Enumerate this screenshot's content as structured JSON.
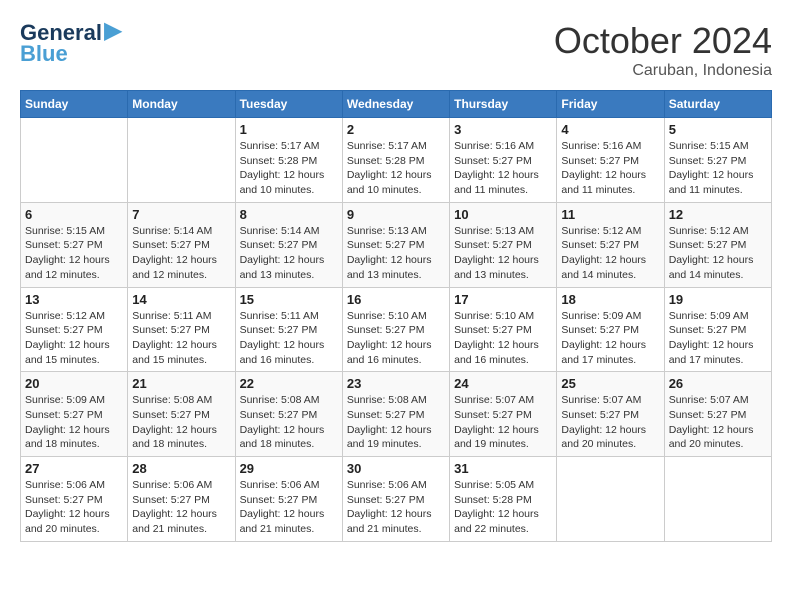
{
  "header": {
    "logo_general": "General",
    "logo_blue": "Blue",
    "month_title": "October 2024",
    "location": "Caruban, Indonesia"
  },
  "days_of_week": [
    "Sunday",
    "Monday",
    "Tuesday",
    "Wednesday",
    "Thursday",
    "Friday",
    "Saturday"
  ],
  "weeks": [
    [
      {
        "day": "",
        "info": ""
      },
      {
        "day": "",
        "info": ""
      },
      {
        "day": "1",
        "info": "Sunrise: 5:17 AM\nSunset: 5:28 PM\nDaylight: 12 hours\nand 10 minutes."
      },
      {
        "day": "2",
        "info": "Sunrise: 5:17 AM\nSunset: 5:28 PM\nDaylight: 12 hours\nand 10 minutes."
      },
      {
        "day": "3",
        "info": "Sunrise: 5:16 AM\nSunset: 5:27 PM\nDaylight: 12 hours\nand 11 minutes."
      },
      {
        "day": "4",
        "info": "Sunrise: 5:16 AM\nSunset: 5:27 PM\nDaylight: 12 hours\nand 11 minutes."
      },
      {
        "day": "5",
        "info": "Sunrise: 5:15 AM\nSunset: 5:27 PM\nDaylight: 12 hours\nand 11 minutes."
      }
    ],
    [
      {
        "day": "6",
        "info": "Sunrise: 5:15 AM\nSunset: 5:27 PM\nDaylight: 12 hours\nand 12 minutes."
      },
      {
        "day": "7",
        "info": "Sunrise: 5:14 AM\nSunset: 5:27 PM\nDaylight: 12 hours\nand 12 minutes."
      },
      {
        "day": "8",
        "info": "Sunrise: 5:14 AM\nSunset: 5:27 PM\nDaylight: 12 hours\nand 13 minutes."
      },
      {
        "day": "9",
        "info": "Sunrise: 5:13 AM\nSunset: 5:27 PM\nDaylight: 12 hours\nand 13 minutes."
      },
      {
        "day": "10",
        "info": "Sunrise: 5:13 AM\nSunset: 5:27 PM\nDaylight: 12 hours\nand 13 minutes."
      },
      {
        "day": "11",
        "info": "Sunrise: 5:12 AM\nSunset: 5:27 PM\nDaylight: 12 hours\nand 14 minutes."
      },
      {
        "day": "12",
        "info": "Sunrise: 5:12 AM\nSunset: 5:27 PM\nDaylight: 12 hours\nand 14 minutes."
      }
    ],
    [
      {
        "day": "13",
        "info": "Sunrise: 5:12 AM\nSunset: 5:27 PM\nDaylight: 12 hours\nand 15 minutes."
      },
      {
        "day": "14",
        "info": "Sunrise: 5:11 AM\nSunset: 5:27 PM\nDaylight: 12 hours\nand 15 minutes."
      },
      {
        "day": "15",
        "info": "Sunrise: 5:11 AM\nSunset: 5:27 PM\nDaylight: 12 hours\nand 16 minutes."
      },
      {
        "day": "16",
        "info": "Sunrise: 5:10 AM\nSunset: 5:27 PM\nDaylight: 12 hours\nand 16 minutes."
      },
      {
        "day": "17",
        "info": "Sunrise: 5:10 AM\nSunset: 5:27 PM\nDaylight: 12 hours\nand 16 minutes."
      },
      {
        "day": "18",
        "info": "Sunrise: 5:09 AM\nSunset: 5:27 PM\nDaylight: 12 hours\nand 17 minutes."
      },
      {
        "day": "19",
        "info": "Sunrise: 5:09 AM\nSunset: 5:27 PM\nDaylight: 12 hours\nand 17 minutes."
      }
    ],
    [
      {
        "day": "20",
        "info": "Sunrise: 5:09 AM\nSunset: 5:27 PM\nDaylight: 12 hours\nand 18 minutes."
      },
      {
        "day": "21",
        "info": "Sunrise: 5:08 AM\nSunset: 5:27 PM\nDaylight: 12 hours\nand 18 minutes."
      },
      {
        "day": "22",
        "info": "Sunrise: 5:08 AM\nSunset: 5:27 PM\nDaylight: 12 hours\nand 18 minutes."
      },
      {
        "day": "23",
        "info": "Sunrise: 5:08 AM\nSunset: 5:27 PM\nDaylight: 12 hours\nand 19 minutes."
      },
      {
        "day": "24",
        "info": "Sunrise: 5:07 AM\nSunset: 5:27 PM\nDaylight: 12 hours\nand 19 minutes."
      },
      {
        "day": "25",
        "info": "Sunrise: 5:07 AM\nSunset: 5:27 PM\nDaylight: 12 hours\nand 20 minutes."
      },
      {
        "day": "26",
        "info": "Sunrise: 5:07 AM\nSunset: 5:27 PM\nDaylight: 12 hours\nand 20 minutes."
      }
    ],
    [
      {
        "day": "27",
        "info": "Sunrise: 5:06 AM\nSunset: 5:27 PM\nDaylight: 12 hours\nand 20 minutes."
      },
      {
        "day": "28",
        "info": "Sunrise: 5:06 AM\nSunset: 5:27 PM\nDaylight: 12 hours\nand 21 minutes."
      },
      {
        "day": "29",
        "info": "Sunrise: 5:06 AM\nSunset: 5:27 PM\nDaylight: 12 hours\nand 21 minutes."
      },
      {
        "day": "30",
        "info": "Sunrise: 5:06 AM\nSunset: 5:27 PM\nDaylight: 12 hours\nand 21 minutes."
      },
      {
        "day": "31",
        "info": "Sunrise: 5:05 AM\nSunset: 5:28 PM\nDaylight: 12 hours\nand 22 minutes."
      },
      {
        "day": "",
        "info": ""
      },
      {
        "day": "",
        "info": ""
      }
    ]
  ]
}
